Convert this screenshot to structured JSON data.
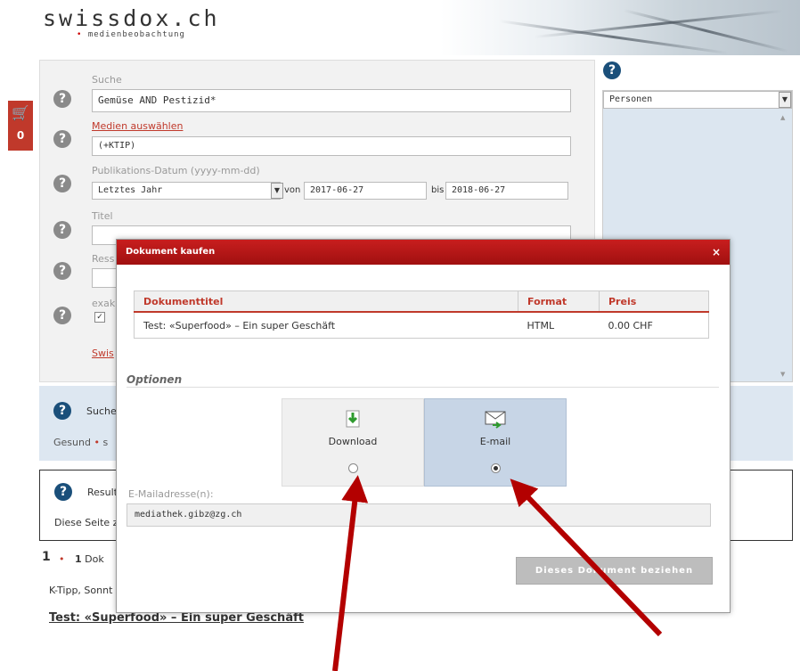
{
  "header": {
    "logo": "swissdox.ch",
    "tagline": "medienbeobachtung"
  },
  "cart": {
    "count": "0"
  },
  "search": {
    "suche_label": "Suche",
    "suche_value": "Gemüse AND Pestizid*",
    "medien_link": "Medien auswählen",
    "medien_value": "(+KTIP)",
    "date_label": "Publikations-Datum (yyyy-mm-dd)",
    "date_range": "Letztes Jahr",
    "von_label": "von",
    "von_value": "2017-06-27",
    "bis_label": "bis",
    "bis_value": "2018-06-27",
    "titel_label": "Titel",
    "ressort_label": "Ress",
    "exakt_label": "exak",
    "swiss_link": "Swis"
  },
  "right": {
    "select_value": "Personen"
  },
  "bluebar": {
    "title": "Suche",
    "text": "Gesund",
    "text2": "s"
  },
  "results": {
    "title": "Result",
    "text": "Diese Seite z"
  },
  "below": {
    "page": "1",
    "count": "1",
    "count_label": "Dok",
    "source": "K-Tipp, Sonnt",
    "article_title": "Test: «Superfood» – Ein super Geschäft"
  },
  "modal": {
    "title": "Dokument kaufen",
    "close": "×",
    "table": {
      "headers": [
        "Dokumenttitel",
        "Format",
        "Preis"
      ],
      "row": [
        "Test: «Superfood» – Ein super Geschäft",
        "HTML",
        "0.00 CHF"
      ]
    },
    "options_title": "Optionen",
    "option_download": "Download",
    "option_email": "E-mail",
    "selected": "E-mail",
    "email_label": "E-Mailadresse(n):",
    "email_value": "mediathek.gibz@zg.ch",
    "buy_button": "Dieses Dokument beziehen"
  },
  "colors": {
    "accent_red": "#c0392b",
    "annotation_arrow": "#b30000",
    "email_selected_bg": "#c7d5e6"
  }
}
